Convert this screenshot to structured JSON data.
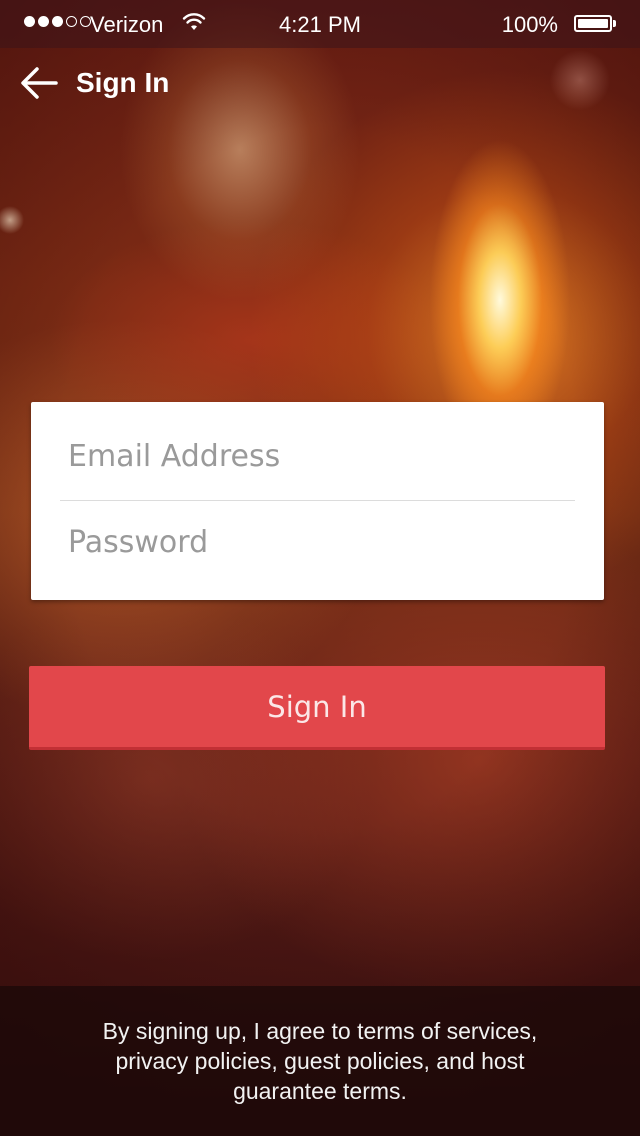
{
  "status_bar": {
    "signal_dots_full": 3,
    "signal_dots_total": 5,
    "carrier": "Verizon",
    "time": "4:21 PM",
    "battery_percent": "100%",
    "battery_level": 1.0
  },
  "header": {
    "back_icon": "arrow-left-icon",
    "title": "Sign In"
  },
  "form": {
    "email_placeholder": "Email Address",
    "email_value": "",
    "password_placeholder": "Password",
    "password_value": ""
  },
  "actions": {
    "sign_in_label": "Sign In"
  },
  "footer": {
    "terms_text": "By signing up, I agree to  terms of services, privacy policies, guest policies, and host guarantee terms."
  },
  "colors": {
    "accent": "#e2474b",
    "card": "#ffffff",
    "placeholder": "#9a9a9a"
  }
}
